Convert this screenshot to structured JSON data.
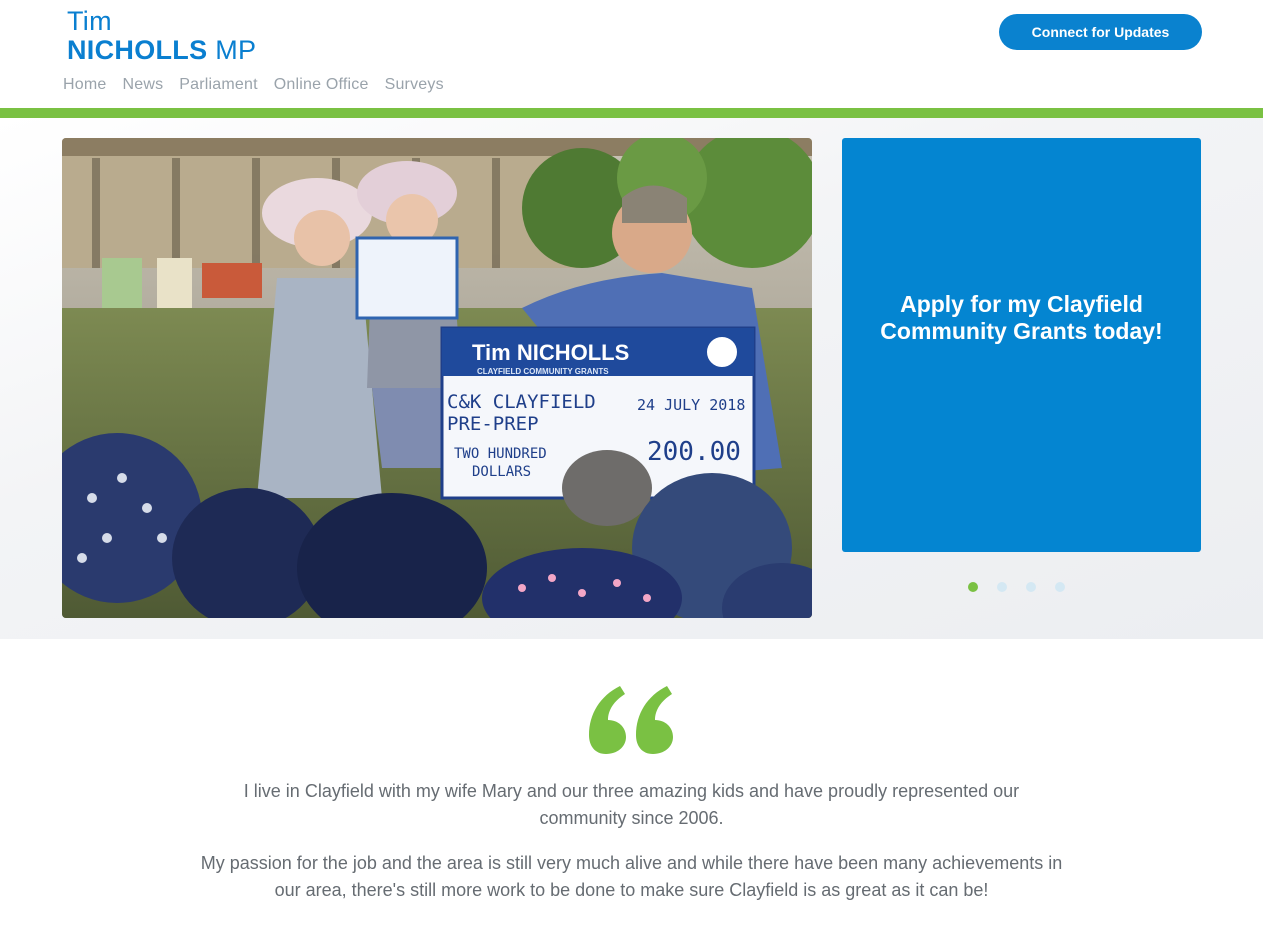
{
  "header": {
    "logo_first": "Tim",
    "logo_last": "NICHOLLS",
    "logo_suffix": "MP",
    "nav": [
      "Home",
      "News",
      "Parliament",
      "Online Office",
      "Surveys"
    ],
    "cta_label": "Connect for Updates"
  },
  "hero": {
    "photo_text": {
      "cheque_name": "Tim NICHOLLS",
      "cheque_subtitle": "CLAYFIELD COMMUNITY GRANTS",
      "payee_line1": "C&K CLAYFIELD",
      "payee_line2": "PRE-PREP",
      "date": "24 JULY 2018",
      "amount_words1": "TWO HUNDRED",
      "amount_words2": "DOLLARS",
      "amount": "200.00"
    },
    "promo_text": "Apply for my Clayfield Community Grants today!",
    "slides": {
      "count": 4,
      "active": 1
    }
  },
  "intro": {
    "paragraph1": "I live in Clayfield with my wife Mary and our three amazing kids and have proudly represented our community since 2006.",
    "paragraph2": "My passion for the job and the area is still very much alive and while there have been many achievements in our area, there's still more work to be done to make sure Clayfield is as great as it can be!"
  },
  "colors": {
    "brand_blue": "#0a82cf",
    "accent_green": "#7ac143",
    "promo_blue": "#0485d1"
  }
}
